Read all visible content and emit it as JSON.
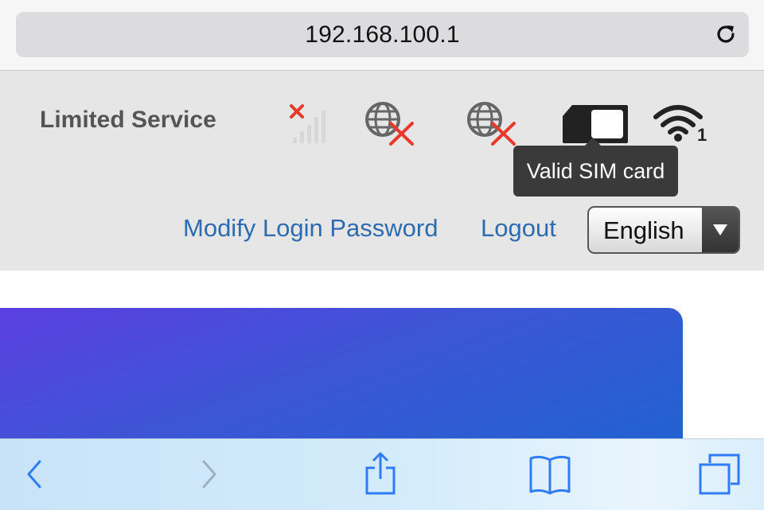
{
  "browser": {
    "url": "192.168.100.1",
    "reload_icon": "reload-icon"
  },
  "status": {
    "service_text": "Limited Service",
    "icons": [
      "signal-no-service-icon",
      "internet-disconnected-icon",
      "roaming-disconnected-icon",
      "sim-card-icon",
      "wifi-icon"
    ],
    "wifi_clients": "1",
    "tooltip": "Valid SIM card"
  },
  "nav": {
    "modify_password": "Modify Login Password",
    "logout": "Logout",
    "language_selected": "English"
  },
  "toolbar": {
    "icons": [
      "back-icon",
      "forward-icon",
      "share-icon",
      "bookmarks-icon",
      "tabs-icon"
    ]
  },
  "colors": {
    "link": "#2d6cb0",
    "error_x": "#e8392b",
    "banner_start": "#5b3fe0",
    "banner_end": "#1e63cf"
  }
}
